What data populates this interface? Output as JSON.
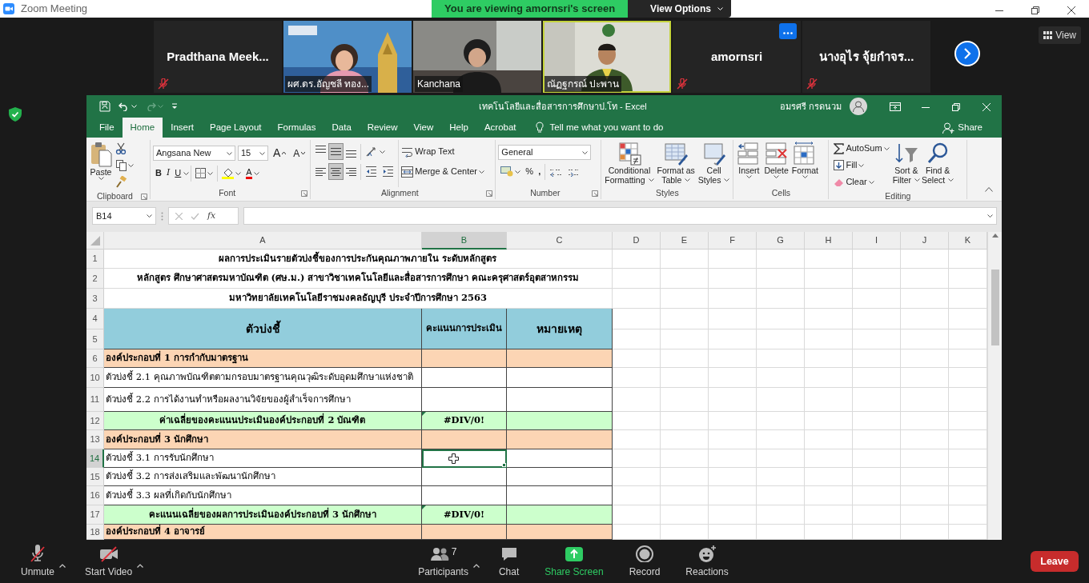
{
  "zoom_window": {
    "title": "Zoom Meeting"
  },
  "share_banner": {
    "text": "You are viewing amornsri's screen",
    "view_options": "View Options"
  },
  "view_button": "View",
  "participants": [
    {
      "kind": "name",
      "name": "Pradthana  Meek...",
      "muted": true,
      "speaking": false,
      "menu": false
    },
    {
      "kind": "video",
      "name": "ผศ.ดร.อัญชลี ทอง...",
      "muted": false,
      "speaking": false,
      "menu": false
    },
    {
      "kind": "video",
      "name": "Kanchana",
      "muted": false,
      "speaking": false,
      "menu": false
    },
    {
      "kind": "video",
      "name": "ณัฏฐกรณ์ ปะพาน",
      "muted": false,
      "speaking": true,
      "menu": false
    },
    {
      "kind": "name",
      "name": "amornsri",
      "muted": true,
      "speaking": false,
      "menu": true
    },
    {
      "kind": "name",
      "name": "นางอุไร จุ้ยกำจร...",
      "muted": true,
      "speaking": false,
      "menu": false
    }
  ],
  "excel": {
    "title": "เทคโนโลยีและสื่อสารการศึกษาป.โท  -  Excel",
    "user": "อมรศรี กรดนวม",
    "tabs": [
      {
        "label": "File",
        "selected": false
      },
      {
        "label": "Home",
        "selected": true
      },
      {
        "label": "Insert",
        "selected": false
      },
      {
        "label": "Page Layout",
        "selected": false
      },
      {
        "label": "Formulas",
        "selected": false
      },
      {
        "label": "Data",
        "selected": false
      },
      {
        "label": "Review",
        "selected": false
      },
      {
        "label": "View",
        "selected": false
      },
      {
        "label": "Help",
        "selected": false
      },
      {
        "label": "Acrobat",
        "selected": false
      }
    ],
    "tell_me": "Tell me what you want to do",
    "share": "Share",
    "ribbon": {
      "clipboard": {
        "paste": "Paste",
        "label": "Clipboard"
      },
      "font": {
        "face": "Angsana New",
        "size": "15",
        "grow": "A",
        "shrink": "A",
        "bold": "B",
        "italic": "I",
        "underline": "U",
        "color_letter": "A",
        "label": "Font"
      },
      "alignment": {
        "vertical": [
          {
            "kind": "top",
            "selected": false
          },
          {
            "kind": "middle",
            "selected": true
          },
          {
            "kind": "bottom",
            "selected": false
          }
        ],
        "horizontal": [
          {
            "kind": "left",
            "selected": false
          },
          {
            "kind": "center",
            "selected": true
          },
          {
            "kind": "right",
            "selected": false
          }
        ],
        "wrap_text": "Wrap Text",
        "merge_center": "Merge & Center",
        "label": "Alignment"
      },
      "number": {
        "format": "General",
        "percent": "%",
        "comma": ",",
        "label": "Number"
      },
      "styles": {
        "buttons": [
          {
            "kind": "conditional",
            "lines": [
              "Conditional",
              "Formatting"
            ]
          },
          {
            "kind": "table",
            "lines": [
              "Format as",
              "Table"
            ]
          },
          {
            "kind": "cellstyles",
            "lines": [
              "Cell",
              "Styles"
            ]
          }
        ],
        "label": "Styles"
      },
      "cells": {
        "buttons": [
          {
            "kind": "insert",
            "lines": [
              "Insert"
            ]
          },
          {
            "kind": "delete",
            "lines": [
              "Delete"
            ]
          },
          {
            "kind": "format",
            "lines": [
              "Format"
            ]
          }
        ],
        "label": "Cells"
      },
      "editing": {
        "autosum": "AutoSum",
        "fill": "Fill",
        "clear": "Clear",
        "sort_filter": [
          "Sort &",
          "Filter"
        ],
        "find_select": [
          "Find &",
          "Select"
        ],
        "label": "Editing"
      }
    },
    "name_box": "B14",
    "fx": "fx",
    "columns": [
      {
        "label": "A",
        "selected": false
      },
      {
        "label": "B",
        "selected": true
      },
      {
        "label": "C",
        "selected": false
      },
      {
        "label": "D",
        "selected": false
      },
      {
        "label": "E",
        "selected": false
      },
      {
        "label": "F",
        "selected": false
      },
      {
        "label": "G",
        "selected": false
      },
      {
        "label": "H",
        "selected": false
      },
      {
        "label": "I",
        "selected": false
      },
      {
        "label": "J",
        "selected": false
      },
      {
        "label": "K",
        "selected": false
      }
    ],
    "rows": [
      {
        "numbers": [
          "1"
        ],
        "kind": "title",
        "cells": [
          "ผลการประเมินรายตัวบ่งชี้ของการประกันคุณภาพภายใน ระดับหลักสูตร"
        ],
        "selected": false
      },
      {
        "numbers": [
          "2"
        ],
        "kind": "title",
        "cells": [
          "หลักสูตร ศึกษาศาสตรมหาบัณฑิต (ศษ.ม.) สาขาวิชาเทคโนโลยีและสื่อสารการศึกษา คณะครุศาสตร์อุตสาหกรรม"
        ],
        "selected": false
      },
      {
        "numbers": [
          "3"
        ],
        "kind": "title",
        "cells": [
          "มหาวิทยาลัยเทคโนโลยีราชมงคลธัญบุรี ประจำปีการศึกษา 2563"
        ],
        "selected": false
      },
      {
        "numbers": [
          "4",
          "5"
        ],
        "kind": "header",
        "cells": [
          "ตัวบ่งชี้",
          "คะแนนการประเมิน",
          "หมายเหตุ"
        ],
        "selected": false
      },
      {
        "numbers": [
          "6"
        ],
        "kind": "section",
        "cells": [
          "องค์ประกอบที่ 1 การกำกับมาตรฐาน"
        ],
        "selected": false
      },
      {
        "numbers": [
          "10"
        ],
        "kind": "item",
        "cells": [
          "ตัวบ่งชี้ 2.1 คุณภาพบัณฑิตตามกรอบมาตรฐานคุณวุฒิระดับอุดมศึกษาแห่งชาติ"
        ],
        "selected": false
      },
      {
        "numbers": [
          "11"
        ],
        "kind": "item",
        "cells": [
          "ตัวบ่งชี้ 2.2 การได้งานทำหรือผลงานวิจัยของผู้สำเร็จการศึกษา"
        ],
        "selected": false
      },
      {
        "numbers": [
          "12"
        ],
        "kind": "average",
        "cells": [
          "ค่าเฉลี่ยของคะแนนประเมินองค์ประกอบที่ 2 บัณฑิต",
          "#DIV/0!"
        ],
        "selected": false
      },
      {
        "numbers": [
          "13"
        ],
        "kind": "section",
        "cells": [
          "องค์ประกอบที่ 3 นักศึกษา"
        ],
        "selected": false
      },
      {
        "numbers": [
          "14"
        ],
        "kind": "item",
        "cells": [
          "ตัวบ่งชี้ 3.1 การรับนักศึกษา"
        ],
        "selected": true
      },
      {
        "numbers": [
          "15"
        ],
        "kind": "item",
        "cells": [
          "ตัวบ่งชี้ 3.2 การส่งเสริมและพัฒนานักศึกษา"
        ],
        "selected": false
      },
      {
        "numbers": [
          "16"
        ],
        "kind": "item",
        "cells": [
          "ตัวบ่งชี้ 3.3 ผลที่เกิดกับนักศึกษา"
        ],
        "selected": false
      },
      {
        "numbers": [
          "17"
        ],
        "kind": "average",
        "cells": [
          "คะแนนเฉลี่ยของผลการประเมินองค์ประกอบที่ 3 นักศึกษา",
          "#DIV/0!"
        ],
        "selected": false
      },
      {
        "numbers": [
          "18"
        ],
        "kind": "section",
        "cells": [
          "องค์ประกอบที่ 4 อาจารย์"
        ],
        "selected": false
      }
    ]
  },
  "toolbar": {
    "items": [
      {
        "kind": "mic",
        "label": "Unmute",
        "menu": true
      },
      {
        "kind": "video",
        "label": "Start Video",
        "menu": true
      },
      {
        "kind": "participants",
        "label": "Participants",
        "count": "7",
        "menu": true
      },
      {
        "kind": "chat",
        "label": "Chat",
        "menu": false
      },
      {
        "kind": "share",
        "label": "Share Screen",
        "menu": false
      },
      {
        "kind": "record",
        "label": "Record",
        "menu": false
      },
      {
        "kind": "reactions",
        "label": "Reactions",
        "menu": false
      }
    ],
    "leave": "Leave"
  }
}
